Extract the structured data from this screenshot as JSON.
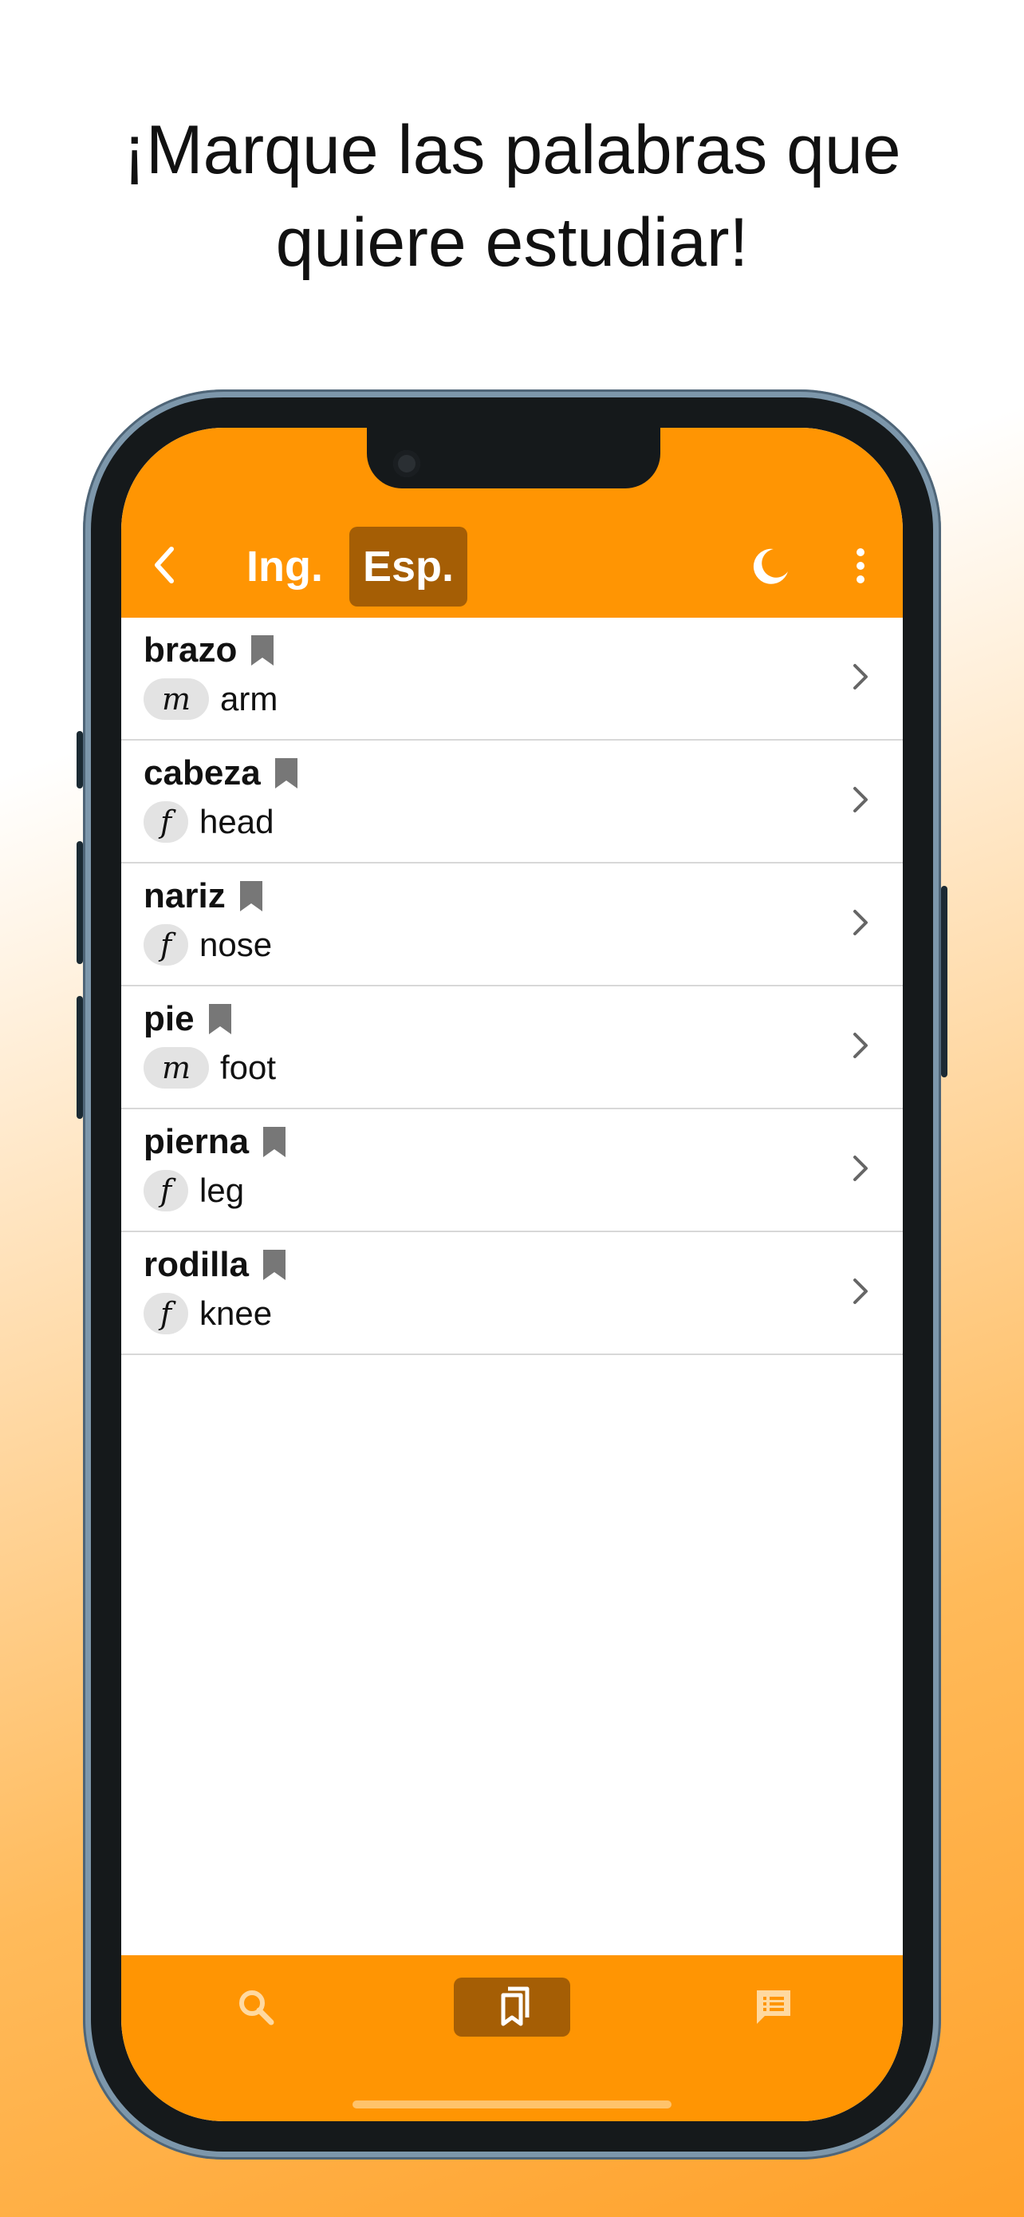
{
  "headline": {
    "line1": "¡Marque las palabras que",
    "line2": "quiere estudiar!"
  },
  "appbar": {
    "tab_en": "Ing.",
    "tab_es": "Esp.",
    "active_tab": "Esp.",
    "icons": [
      "back-arrow-icon",
      "moon-icon",
      "more-vert-icon"
    ]
  },
  "words": [
    {
      "word": "brazo",
      "gender": "m",
      "translation": "arm"
    },
    {
      "word": "cabeza",
      "gender": "f",
      "translation": "head"
    },
    {
      "word": "nariz",
      "gender": "f",
      "translation": "nose"
    },
    {
      "word": "pie",
      "gender": "m",
      "translation": "foot"
    },
    {
      "word": "pierna",
      "gender": "f",
      "translation": "leg"
    },
    {
      "word": "rodilla",
      "gender": "f",
      "translation": "knee"
    }
  ],
  "bottom_nav": {
    "items": [
      "search-icon",
      "bookmarks-icon",
      "messages-icon"
    ],
    "active": "bookmarks-icon"
  },
  "colors": {
    "accent": "#ff9503",
    "accent_dark": "#a55e05",
    "bookmark": "#777777"
  }
}
